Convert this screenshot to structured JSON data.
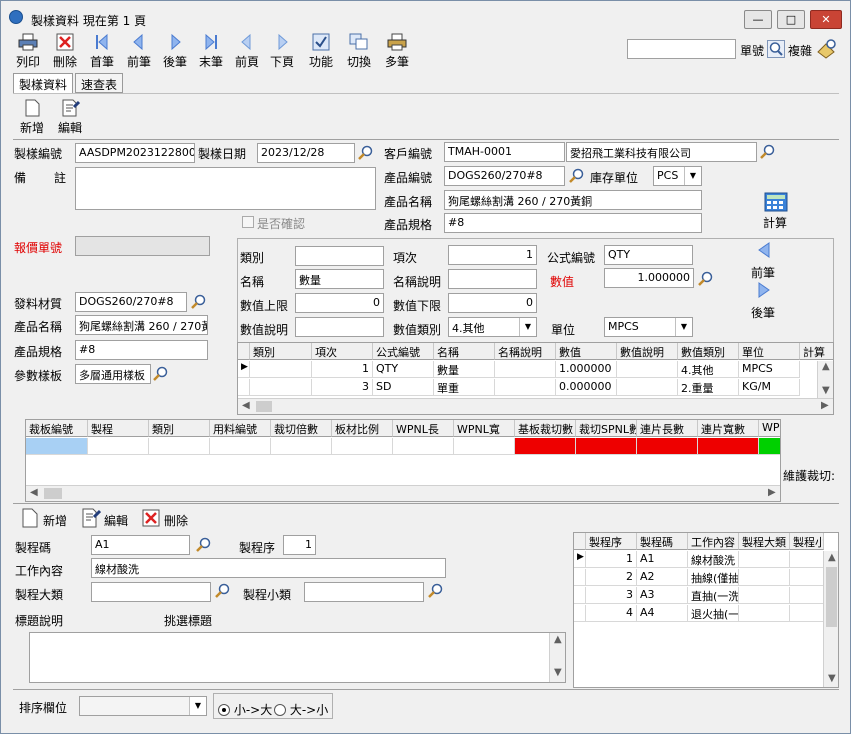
{
  "window": {
    "title": "製樣資料  現在第 1 頁",
    "min": "—",
    "max": "□",
    "close": "✕"
  },
  "toolbar": [
    {
      "label": "列印",
      "icon": "printer-icon"
    },
    {
      "label": "刪除",
      "icon": "delete-icon"
    },
    {
      "label": "首筆",
      "icon": "first-record-icon"
    },
    {
      "label": "前筆",
      "icon": "prev-record-icon"
    },
    {
      "label": "後筆",
      "icon": "next-record-icon"
    },
    {
      "label": "末筆",
      "icon": "last-record-icon"
    },
    {
      "label": "前頁",
      "icon": "prev-page-icon"
    },
    {
      "label": "下頁",
      "icon": "next-page-icon"
    },
    {
      "label": "功能",
      "icon": "function-icon"
    },
    {
      "label": "切換",
      "icon": "switch-icon"
    },
    {
      "label": "多筆",
      "icon": "multi-record-icon"
    }
  ],
  "search": {
    "value": "",
    "order_no_label": "單號",
    "complex_label": "複雜"
  },
  "tabs": [
    "製樣資料",
    "速查表"
  ],
  "subtoolbar": {
    "new": "新增",
    "edit": "編輯"
  },
  "header": {
    "sample_no_label": "製樣編號",
    "sample_no": "AASDPM202312280001",
    "sample_date_label": "製樣日期",
    "sample_date": "2023/12/28",
    "customer_no_label": "客戶編號",
    "customer_no": "TMAH-0001",
    "customer_name": "愛招飛工業科技有限公司",
    "remark_label_1": "備",
    "remark_label_2": "註",
    "remark": "",
    "product_code_label": "產品編號",
    "product_code": "DOGS260/270#8",
    "stock_unit_label": "庫存單位",
    "stock_unit": "PCS",
    "product_name_label": "產品名稱",
    "product_name": "狗尾螺絲割溝  260 / 270黃銅",
    "product_spec_label": "產品規格",
    "product_spec": "#8",
    "confirmed_label": "是否確認",
    "calc_label": "計算",
    "quote_no_label": "報價單號",
    "quote_no": "",
    "material_label": "發料材質",
    "material": "DOGS260/270#8",
    "mat_product_name_label": "產品名稱",
    "mat_product_name": "狗尾螺絲割溝  260 / 270黃",
    "mat_product_spec_label": "產品規格",
    "mat_product_spec": "#8",
    "param_template_label": "參數樣板",
    "param_template": "多層通用樣板"
  },
  "param": {
    "type_label": "類別",
    "type": "",
    "item_label": "項次",
    "item": "1",
    "formula_label": "公式編號",
    "formula": "QTY",
    "name_label": "名稱",
    "name": "數量",
    "name_desc_label": "名稱說明",
    "name_desc": "",
    "value_label": "數值",
    "value": "1.000000",
    "upper_label": "數值上限",
    "upper": "0",
    "lower_label": "數值下限",
    "lower": "0",
    "value_desc_label": "數值說明",
    "value_desc": "",
    "value_type_label": "數值類別",
    "value_type": "4.其他",
    "unit_label": "單位",
    "unit": "MPCS",
    "prev_label": "前筆",
    "next_label": "後筆"
  },
  "param_grid": {
    "columns": [
      "類別",
      "項次",
      "公式編號",
      "名稱",
      "名稱說明",
      "數值",
      "數值說明",
      "數值類別",
      "單位",
      "計算"
    ],
    "rows": [
      [
        "",
        "1",
        "QTY",
        "數量",
        "",
        "1.000000",
        "",
        "4.其他",
        "MPCS",
        ""
      ],
      [
        "",
        "3",
        "SD",
        "單重",
        "",
        "0.000000",
        "",
        "2.重量",
        "KG/M",
        ""
      ]
    ]
  },
  "cut_grid": {
    "columns": [
      "裁板編號",
      "製程",
      "類別",
      "用料編號",
      "裁切倍數",
      "板材比例",
      "WPNL長",
      "WPNL寬",
      "基板裁切數",
      "裁切SPNL數",
      "連片長數",
      "連片寬數",
      "WP"
    ],
    "side_label": "維護裁切:"
  },
  "process_toolbar": {
    "new": "新增",
    "edit": "編輯",
    "delete": "刪除"
  },
  "process": {
    "code_label": "製程碼",
    "code": "A1",
    "seq_label": "製程序",
    "seq": "1",
    "content_label": "工作內容",
    "content": "線材酸洗",
    "major_label": "製程大類",
    "major": "",
    "minor_label": "製程小類",
    "minor": "",
    "title_desc_label": "標題說明",
    "pick_title_label": "挑選標題"
  },
  "process_grid": {
    "columns": [
      "製程序",
      "製程碼",
      "工作內容",
      "製程大類",
      "製程小類"
    ],
    "rows": [
      [
        "1",
        "A1",
        "線材酸洗",
        "",
        ""
      ],
      [
        "2",
        "A2",
        "抽線(僅抽",
        "",
        ""
      ],
      [
        "3",
        "A3",
        "直抽(一洗",
        "",
        ""
      ],
      [
        "4",
        "A4",
        "退火抽(一",
        "",
        ""
      ]
    ]
  },
  "sort": {
    "label": "排序欄位",
    "value": "",
    "asc": "小->大",
    "desc": "大->小"
  }
}
